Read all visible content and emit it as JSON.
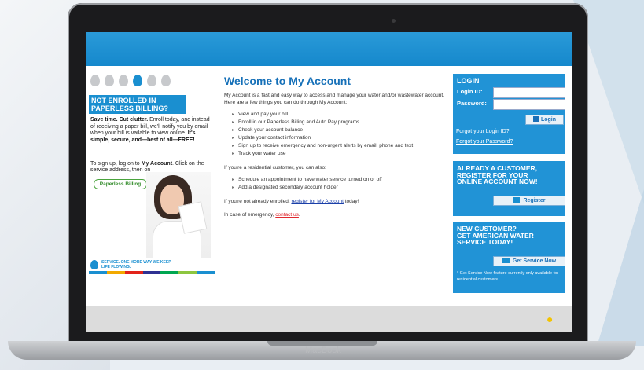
{
  "device": {
    "brand": "MacBook"
  },
  "promo": {
    "title_line1": "NOT ENROLLED IN",
    "title_line2": "PAPERLESS BILLING?",
    "body_bold": "Save time. Cut clutter.",
    "body_text": " Enroll today, and instead of receiving a paper bill, we'll notify you by email when your bill is vailable to view online. ",
    "body_bold2": "It's simple, secure, and—best of all—FREE!",
    "signup_text_a": "To sign up, log on to ",
    "signup_bold": "My Account",
    "signup_text_b": ". Click on the service address, then on",
    "button_label": "Paperless Billing",
    "tagline": "SERVICE. ONE MORE WAY WE KEEP LIFE FLOWING.",
    "stripe_colors": [
      "#1a8fd0",
      "#f2a900",
      "#e2231a",
      "#2e3192",
      "#00a651",
      "#8dc63f",
      "#1a8fd0"
    ]
  },
  "main": {
    "heading": "Welcome to My Account",
    "intro": "My Account is a fast and easy way to access and manage your water and/or wastewater account. Here are a few things you can do through My Account:",
    "list1": [
      "View and pay your bill",
      "Enroll in our Paperless Billing and Auto Pay programs",
      "Check your account balance",
      "Update your contact information",
      "Sign up to receive emergency and non-urgent alerts by email, phone and text",
      "Track your water use"
    ],
    "residential_text": "If you're a residential customer, you can also:",
    "list2": [
      "Schedule an appointment to have water service turned on or off",
      "Add a designated secondary account holder"
    ],
    "enroll_a": "If you're not already enrolled, ",
    "enroll_link": "register for My Account",
    "enroll_b": " today!",
    "emergency_a": "In case of emergency, ",
    "emergency_link": "contact us",
    "emergency_b": "."
  },
  "login": {
    "title": "LOGIN",
    "login_id_label": "Login ID:",
    "password_label": "Password:",
    "login_id_value": "",
    "password_value": "",
    "button": "Login",
    "forgot_id": "Forgot your Login ID?",
    "forgot_password": "Forgot your Password?"
  },
  "register": {
    "title_line1": "ALREADY A CUSTOMER,",
    "title_line2": "REGISTER FOR YOUR",
    "title_line3": "ONLINE ACCOUNT NOW!",
    "button": "Register"
  },
  "new_customer": {
    "title_line1": "NEW CUSTOMER?",
    "title_line2": "GET AMERICAN WATER",
    "title_line3": "SERVICE TODAY!",
    "button": "Get Service Now",
    "note": "* Get Service Now feature currently only available for residential customers"
  },
  "colors": {
    "accent": "#1a8fd0",
    "panel": "#2193d6",
    "heading": "#1670b8",
    "link": "#1a3fa8",
    "link_alert": "#e0282e"
  }
}
